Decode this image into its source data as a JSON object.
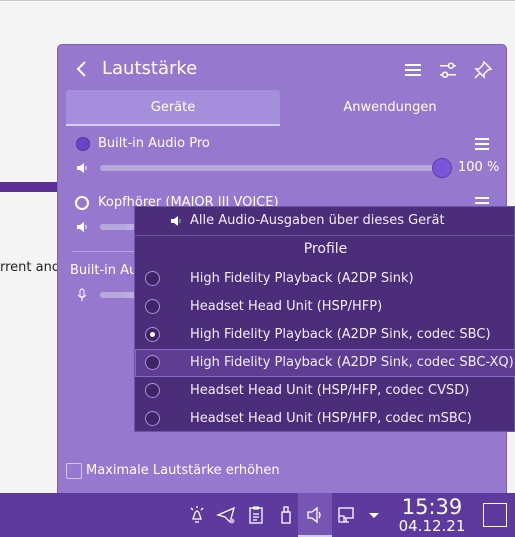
{
  "background": {
    "text_fragment": "rrent and "
  },
  "popup": {
    "title": "Lautstärke",
    "tabs": [
      {
        "label": "Geräte",
        "active": true
      },
      {
        "label": "Anwendungen",
        "active": false
      }
    ],
    "devices": [
      {
        "label": "Built-in Audio Pro",
        "volume_percent": 100,
        "volume_text": "100 %"
      },
      {
        "label": "Kopfhörer (MAJOR III VOICE)",
        "volume_percent": 8
      }
    ],
    "input_device": {
      "label": "Built-in Au",
      "volume_percent": 8
    },
    "raise_max_volume_label": "Maximale Lautstärke erhöhen"
  },
  "context_menu": {
    "route_all_label": "Alle Audio-Ausgaben über dieses Gerät",
    "section_title": "Profile",
    "profiles": [
      {
        "label": "High Fidelity Playback (A2DP Sink)",
        "selected": false
      },
      {
        "label": "Headset Head Unit (HSP/HFP)",
        "selected": false
      },
      {
        "label": "High Fidelity Playback (A2DP Sink, codec SBC)",
        "selected": true
      },
      {
        "label": "High Fidelity Playback (A2DP Sink, codec SBC-XQ)",
        "selected": false,
        "highlighted": true
      },
      {
        "label": "Headset Head Unit (HSP/HFP, codec CVSD)",
        "selected": false
      },
      {
        "label": "Headset Head Unit (HSP/HFP, codec mSBC)",
        "selected": false
      }
    ]
  },
  "taskbar": {
    "time": "15:39",
    "date": "04.12.21"
  },
  "colors": {
    "popup_bg": "#9679ce",
    "menu_bg": "#4b2d7a",
    "taskbar_bg": "#5f3a9e",
    "accent": "#7b55d6"
  }
}
